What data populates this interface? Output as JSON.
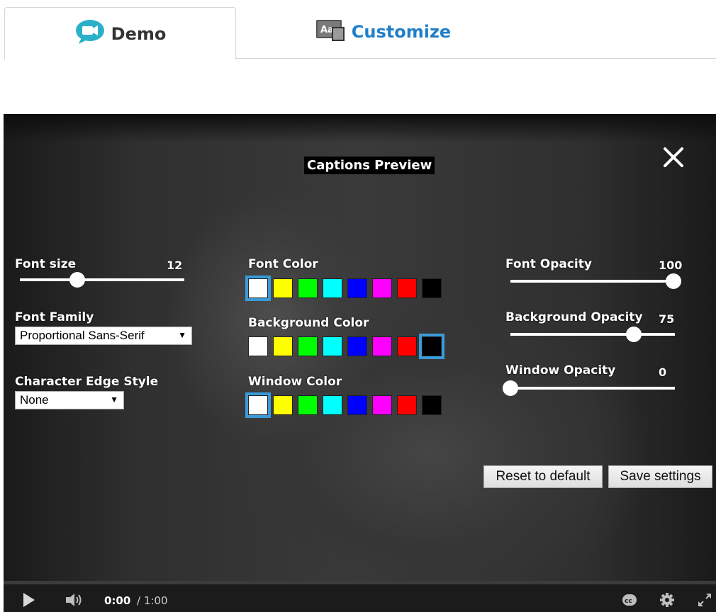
{
  "tabs": [
    {
      "label": "Demo",
      "icon": "video-chat-icon",
      "active": true
    },
    {
      "label": "Customize",
      "icon": "font-aa-icon",
      "active": false
    }
  ],
  "preview": {
    "title": "Captions Preview",
    "close_icon": "close-icon"
  },
  "font_size": {
    "label": "Font size",
    "value": "12",
    "level": 0.35
  },
  "font_family": {
    "label": "Font Family",
    "selected": "Proportional Sans-Serif"
  },
  "edge_style": {
    "label": "Character Edge Style",
    "selected": "None"
  },
  "font_color": {
    "label": "Font Color",
    "selected_index": 0
  },
  "background_color": {
    "label": "Background Color",
    "selected_index": 7
  },
  "window_color": {
    "label": "Window Color",
    "selected_index": 0
  },
  "swatch_colors": [
    "#ffffff",
    "#ffff00",
    "#00ff00",
    "#00ffff",
    "#0000ff",
    "#ff00ff",
    "#ff0000",
    "#000000"
  ],
  "font_opacity": {
    "label": "Font Opacity",
    "value": "100",
    "level": 1.0
  },
  "background_opacity": {
    "label": "Background Opacity",
    "value": "75",
    "level": 0.75
  },
  "window_opacity": {
    "label": "Window Opacity",
    "value": "0",
    "level": 0.0
  },
  "buttons": {
    "reset": "Reset to default",
    "save": "Save settings"
  },
  "player": {
    "current_time": "0:00",
    "duration": "/ 1:00",
    "icons": [
      "play-icon",
      "volume-icon",
      "cc-icon",
      "settings-gear-icon",
      "fullscreen-icon"
    ]
  },
  "colors": {
    "accent": "#3a9ad9",
    "customize_tab": "#1f7fc8"
  }
}
